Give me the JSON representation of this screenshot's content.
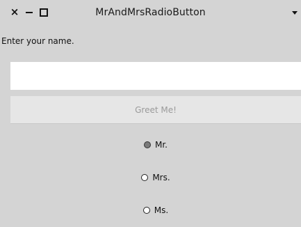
{
  "window": {
    "title": "MrAndMrsRadioButton",
    "close_glyph": "×"
  },
  "form": {
    "prompt": "Enter your name.",
    "name_value": "",
    "greet_label": "Greet Me!"
  },
  "radios": [
    {
      "label": "Mr.",
      "checked": true
    },
    {
      "label": "Mrs.",
      "checked": false
    },
    {
      "label": "Ms.",
      "checked": false
    }
  ],
  "colors": {
    "background": "#d4d4d4",
    "input_background": "#ffffff",
    "button_background": "#e6e6e6",
    "button_text_disabled": "#9a9a9a",
    "radio_checked_fill": "#7a7a7a"
  },
  "icons": {
    "close": "close-icon",
    "minimize": "minimize-icon",
    "maximize": "maximize-icon",
    "menu": "chevron-down-icon"
  }
}
